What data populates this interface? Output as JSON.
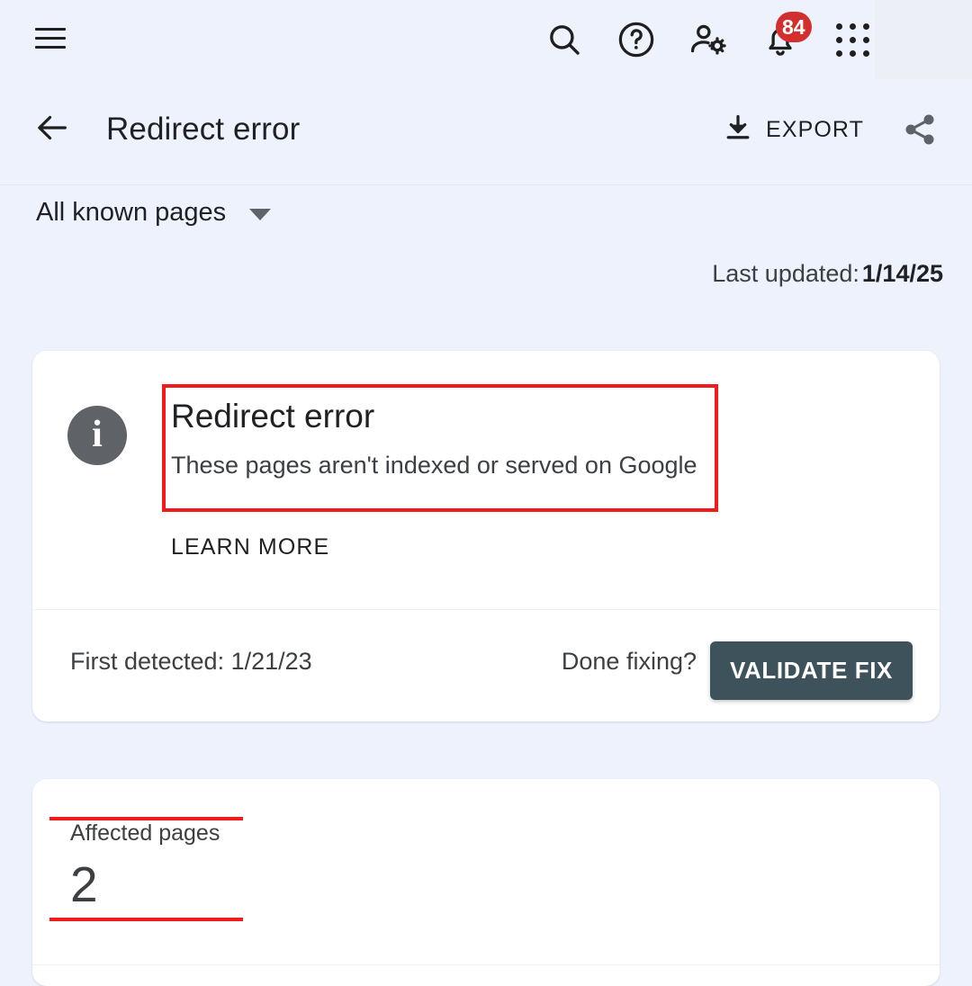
{
  "topbar": {
    "menu_icon": "hamburger-menu-icon",
    "icons": [
      {
        "name": "search-icon",
        "label": "Search"
      },
      {
        "name": "help-icon",
        "label": "Help"
      },
      {
        "name": "account-settings-icon",
        "label": "Account settings"
      },
      {
        "name": "notifications-bell-icon",
        "label": "Notifications",
        "badge": "84"
      },
      {
        "name": "apps-grid-icon",
        "label": "Google apps"
      }
    ],
    "notification_count": "84"
  },
  "header": {
    "back_label": "Back",
    "title": "Redirect error",
    "export_label": "EXPORT",
    "export_icon": "download-icon",
    "share_icon": "share-icon"
  },
  "filter": {
    "selected": "All known pages",
    "caret_icon": "chevron-down-icon"
  },
  "status": {
    "last_updated_label": "Last updated:",
    "last_updated_value": "1/14/25"
  },
  "detail_card": {
    "info_icon": "info-circle-icon",
    "info_glyph": "i",
    "issue_title": "Redirect error",
    "issue_subtitle": "These pages aren't indexed or served on Google",
    "learn_more_label": "LEARN MORE",
    "first_detected": "First detected: 1/21/23",
    "done_fixing_label": "Done fixing?",
    "validate_button_label": "VALIDATE FIX"
  },
  "affected_card": {
    "label": "Affected pages",
    "value": "2"
  },
  "annotations": {
    "box_color": "#f21b1b",
    "line_color": "#f21b1b"
  },
  "colors": {
    "page_background": "#eef2fc",
    "card_background": "#ffffff",
    "validate_button": "#3e525c",
    "badge_red": "#d32f2f",
    "info_icon_gray": "#5f6368",
    "text_primary": "#202124",
    "text_secondary": "#3c4043"
  }
}
